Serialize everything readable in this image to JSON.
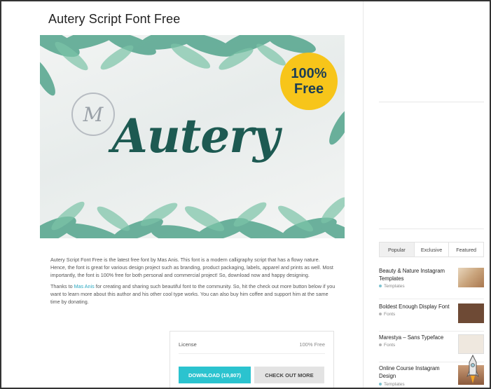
{
  "page": {
    "title": "Autery Script Font Free"
  },
  "hero": {
    "font_name": "Autery",
    "badge_line1": "100%",
    "badge_line2": "Free",
    "stamp_letter": "M"
  },
  "description": {
    "p1": "Autery Script Font Free is the latest free font by Mas Anis. This font is a modern calligraphy script that has a flowy nature. Hence, the font is great for various design project such as branding, product packaging, labels, apparel and prints as well. Most importantly, the font is 100% free for both personal and commercial project! So, download now and happy designing.",
    "p2_before": "Thanks to ",
    "p2_link": "Mas Anis",
    "p2_after": " for creating and sharing such beautiful font to the community. So, hit the check out more button below if you want to learn more about this author and his other cool type works. You can also buy him coffee and support him at the same time by donating."
  },
  "download_box": {
    "license_label": "License",
    "license_value": "100% Free",
    "download_label": "DOWNLOAD (19,807)",
    "more_label": "CHECK OUT MORE"
  },
  "sidebar": {
    "tabs": [
      {
        "label": "Popular"
      },
      {
        "label": "Exclusive"
      },
      {
        "label": "Featured"
      }
    ],
    "posts": [
      {
        "title": "Beauty & Nature Instagram Templates",
        "category": "Templates",
        "dot": "#7fc3d0",
        "thumb": "#c9a47c"
      },
      {
        "title": "Boldest Enough Display Font",
        "category": "Fonts",
        "dot": "#b5b5b5",
        "thumb": "#6e4a35"
      },
      {
        "title": "Marestya – Sans Typeface",
        "category": "Fonts",
        "dot": "#b5b5b5",
        "thumb": "#efe8df"
      },
      {
        "title": "Online Course Instagram Design",
        "category": "Templates",
        "dot": "#7fc3d0",
        "thumb": "#8b5a3c"
      }
    ]
  },
  "colors": {
    "accent": "#2bc3cf",
    "badge": "#f7c51a",
    "link": "#2aa7c0",
    "hero_text": "#1d5a52"
  }
}
